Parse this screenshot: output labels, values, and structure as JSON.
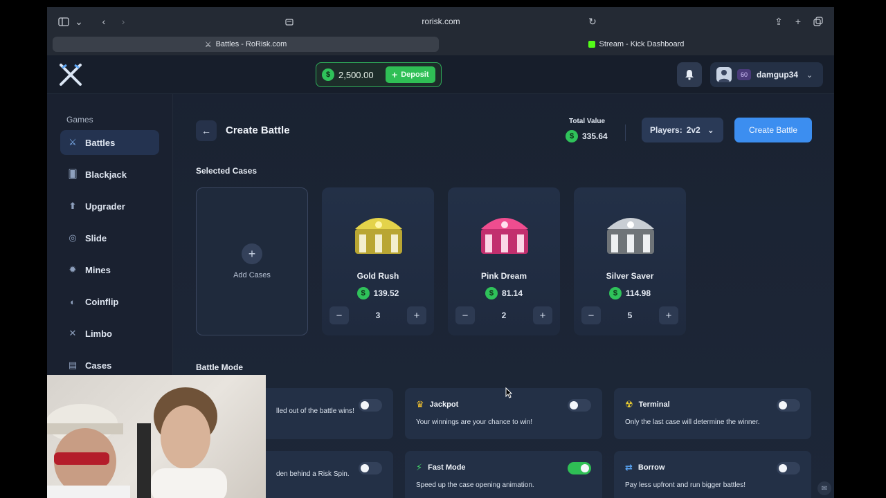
{
  "browser": {
    "url": "rorisk.com",
    "tabs": [
      {
        "label": "Battles - RoRisk.com",
        "active": true
      },
      {
        "label": "Stream - Kick Dashboard",
        "active": false
      }
    ]
  },
  "header": {
    "balance": "2,500.00",
    "deposit_label": "Deposit",
    "level": "60",
    "username": "damgup34"
  },
  "sidebar": {
    "title": "Games",
    "items": [
      {
        "label": "Battles",
        "icon": "swords-icon",
        "active": true
      },
      {
        "label": "Blackjack",
        "icon": "cards-icon"
      },
      {
        "label": "Upgrader",
        "icon": "upgrade-icon"
      },
      {
        "label": "Slide",
        "icon": "slide-icon"
      },
      {
        "label": "Mines",
        "icon": "mine-icon"
      },
      {
        "label": "Coinflip",
        "icon": "coin-icon"
      },
      {
        "label": "Limbo",
        "icon": "limbo-icon"
      },
      {
        "label": "Cases",
        "icon": "case-icon"
      }
    ]
  },
  "main": {
    "title": "Create Battle",
    "total_value_label": "Total Value",
    "total_value": "335.64",
    "players_label": "Players:",
    "players_value": "2v2",
    "create_label": "Create Battle",
    "selected_cases_title": "Selected Cases",
    "add_cases_label": "Add Cases",
    "cases": [
      {
        "name": "Gold Rush",
        "price": "139.52",
        "qty": "3",
        "color": "#d8c23a"
      },
      {
        "name": "Pink Dream",
        "price": "81.14",
        "qty": "2",
        "color": "#ec3f86"
      },
      {
        "name": "Silver Saver",
        "price": "114.98",
        "qty": "5",
        "color": "#c8ccd2"
      }
    ],
    "battle_mode_title": "Battle Mode",
    "modes": [
      {
        "title": "",
        "desc": "lled out of the battle wins!",
        "on": false
      },
      {
        "title": "Jackpot",
        "desc": "Your winnings are your chance to win!",
        "on": false,
        "icon": "crown-icon"
      },
      {
        "title": "Terminal",
        "desc": "Only the last case will determine the winner.",
        "on": false,
        "icon": "radioactive-icon"
      },
      {
        "title": "",
        "desc": "den behind a Risk Spin.",
        "on": false
      },
      {
        "title": "Fast Mode",
        "desc": "Speed up the case opening animation.",
        "on": true,
        "icon": "lightning-icon"
      },
      {
        "title": "Borrow",
        "desc": "Pay less upfront and run bigger battles!",
        "on": false,
        "icon": "borrow-icon"
      }
    ]
  },
  "colors": {
    "accent": "#3c8ef0",
    "money": "#2fc25a"
  }
}
